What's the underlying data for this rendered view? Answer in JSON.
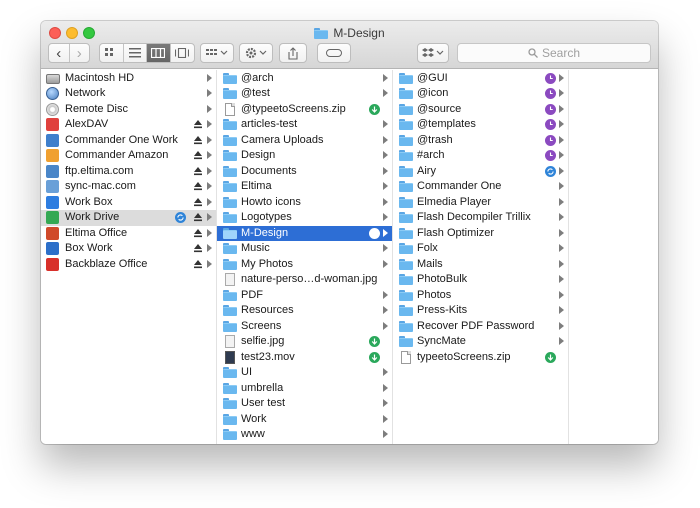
{
  "window": {
    "title": "M-Design"
  },
  "toolbar": {
    "back": "‹",
    "forward": "›",
    "search_placeholder": "Search"
  },
  "colors": {
    "selection": "#2d6ed5",
    "folder": "#6ab8ef",
    "download_badge": "#2aa85b",
    "clock_badge": "#8b4ac0",
    "sync_badge": "#2f84d8"
  },
  "sidebar": {
    "items": [
      {
        "label": "Macintosh HD",
        "icon": "hard-disk-icon"
      },
      {
        "label": "Network",
        "icon": "network-globe-icon"
      },
      {
        "label": "Remote Disc",
        "icon": "remote-disc-icon"
      },
      {
        "label": "AlexDAV",
        "icon": "webdav-icon",
        "eject": true
      },
      {
        "label": "Commander One Work",
        "icon": "commander-one-icon",
        "eject": true
      },
      {
        "label": "Commander Amazon",
        "icon": "amazon-icon",
        "eject": true
      },
      {
        "label": "ftp.eltima.com",
        "icon": "ftp-icon",
        "eject": true
      },
      {
        "label": "sync-mac.com",
        "icon": "sync-mac-icon",
        "eject": true
      },
      {
        "label": "Work Box",
        "icon": "dropbox-icon",
        "eject": true
      },
      {
        "label": "Work Drive",
        "icon": "google-drive-icon",
        "eject": true,
        "sync": true,
        "selected": true
      },
      {
        "label": "Eltima Office",
        "icon": "office-icon",
        "eject": true
      },
      {
        "label": "Box Work",
        "icon": "box-icon",
        "eject": true
      },
      {
        "label": "Backblaze Office",
        "icon": "backblaze-icon",
        "eject": true
      }
    ]
  },
  "column2": {
    "items": [
      {
        "label": "@arch",
        "kind": "folder"
      },
      {
        "label": "@test",
        "kind": "folder"
      },
      {
        "label": "@typeetoScreens.zip",
        "kind": "zip",
        "badge": "download"
      },
      {
        "label": "articles-test",
        "kind": "folder"
      },
      {
        "label": "Camera Uploads",
        "kind": "folder"
      },
      {
        "label": "Design",
        "kind": "folder"
      },
      {
        "label": "Documents",
        "kind": "folder"
      },
      {
        "label": "Eltima",
        "kind": "folder"
      },
      {
        "label": "Howto icons",
        "kind": "folder"
      },
      {
        "label": "Logotypes",
        "kind": "folder"
      },
      {
        "label": "M-Design",
        "kind": "folder",
        "selected": true,
        "badge": "sync"
      },
      {
        "label": "Music",
        "kind": "folder"
      },
      {
        "label": "My Photos",
        "kind": "folder"
      },
      {
        "label": "nature-perso…d-woman.jpg",
        "kind": "image"
      },
      {
        "label": "PDF",
        "kind": "folder"
      },
      {
        "label": "Resources",
        "kind": "folder"
      },
      {
        "label": "Screens",
        "kind": "folder"
      },
      {
        "label": "selfie.jpg",
        "kind": "image",
        "badge": "download"
      },
      {
        "label": "test23.mov",
        "kind": "movie",
        "badge": "download"
      },
      {
        "label": "UI",
        "kind": "folder"
      },
      {
        "label": "umbrella",
        "kind": "folder"
      },
      {
        "label": "User test",
        "kind": "folder"
      },
      {
        "label": "Work",
        "kind": "folder"
      },
      {
        "label": "www",
        "kind": "folder"
      }
    ]
  },
  "column3": {
    "items": [
      {
        "label": "@GUI",
        "kind": "folder",
        "badge": "clock"
      },
      {
        "label": "@icon",
        "kind": "folder",
        "badge": "clock"
      },
      {
        "label": "@source",
        "kind": "folder",
        "badge": "clock"
      },
      {
        "label": "@templates",
        "kind": "folder",
        "badge": "clock"
      },
      {
        "label": "@trash",
        "kind": "folder",
        "badge": "clock"
      },
      {
        "label": "#arch",
        "kind": "folder",
        "badge": "clock"
      },
      {
        "label": "Airy",
        "kind": "folder",
        "badge": "sync"
      },
      {
        "label": "Commander One",
        "kind": "folder"
      },
      {
        "label": "Elmedia Player",
        "kind": "folder"
      },
      {
        "label": "Flash Decompiler Trillix",
        "kind": "folder"
      },
      {
        "label": "Flash Optimizer",
        "kind": "folder"
      },
      {
        "label": "Folx",
        "kind": "folder"
      },
      {
        "label": "Mails",
        "kind": "folder"
      },
      {
        "label": "PhotoBulk",
        "kind": "folder"
      },
      {
        "label": "Photos",
        "kind": "folder"
      },
      {
        "label": "Press-Kits",
        "kind": "folder"
      },
      {
        "label": "Recover PDF Password",
        "kind": "folder"
      },
      {
        "label": "SyncMate",
        "kind": "folder"
      },
      {
        "label": "typeetoScreens.zip",
        "kind": "zip",
        "badge": "download"
      }
    ]
  }
}
